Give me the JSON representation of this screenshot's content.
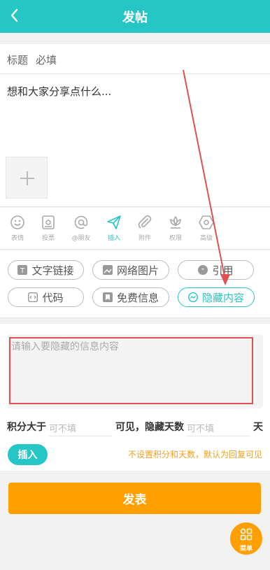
{
  "header": {
    "title": "发帖"
  },
  "title_field": {
    "label": "标题",
    "placeholder": "必填"
  },
  "content_field": {
    "placeholder": "想和大家分享点什么..."
  },
  "toolbar": {
    "items": [
      {
        "label": "表情",
        "icon": "smiley-icon"
      },
      {
        "label": "投票",
        "icon": "vote-icon"
      },
      {
        "label": "@朋友",
        "icon": "at-icon"
      },
      {
        "label": "插入",
        "icon": "send-icon",
        "active": true
      },
      {
        "label": "附件",
        "icon": "paperclip-icon"
      },
      {
        "label": "权限",
        "icon": "lotus-icon"
      },
      {
        "label": "高级",
        "icon": "hexagon-icon"
      }
    ]
  },
  "insert_options": [
    {
      "label": "文字链接",
      "icon": "text-link-icon"
    },
    {
      "label": "网络图片",
      "icon": "image-icon"
    },
    {
      "label": "引用",
      "icon": "quote-icon"
    },
    {
      "label": "代码",
      "icon": "code-icon"
    },
    {
      "label": "免费信息",
      "icon": "bookmark-icon"
    },
    {
      "label": "隐藏内容",
      "icon": "chat-icon",
      "active": true
    }
  ],
  "hidden_content": {
    "placeholder": "请输入要隐藏的信息内容",
    "points_label": "积分大于",
    "points_placeholder": "可不填",
    "visible_days_label": "可见，隐藏天数",
    "days_placeholder": "可不填",
    "days_unit": "天",
    "insert_label": "插入",
    "hint": "不设置积分和天数，默认为回复可见"
  },
  "publish_label": "发表",
  "menu_label": "菜单",
  "colors": {
    "accent": "#26c6c6",
    "orange": "#ff9f00",
    "annotation": "#e05050"
  }
}
